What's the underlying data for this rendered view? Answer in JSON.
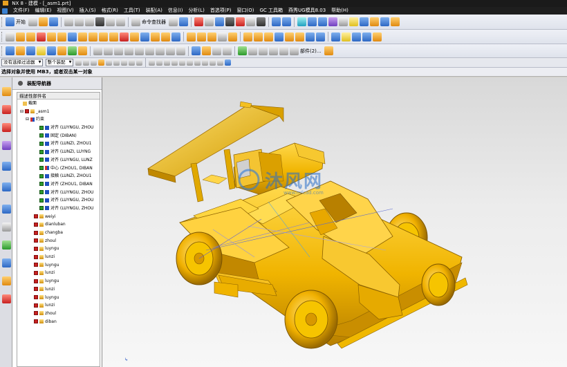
{
  "window": {
    "title": "NX 8 - 建模 - [_asm1.prt]"
  },
  "menubar": {
    "items": [
      "文件(F)",
      "编辑(E)",
      "视图(V)",
      "插入(S)",
      "格式(R)",
      "工具(T)",
      "装配(A)",
      "信息(I)",
      "分析(L)",
      "首选项(P)",
      "窗口(O)",
      "GC 工具箱",
      "燕秀UG模具8.03",
      "帮助(H)"
    ]
  },
  "toolbar": {
    "start_label": "开始",
    "command_finder_label": "命令查找器",
    "assembly_label": "部件(2)..."
  },
  "selection": {
    "filter_value": "没有选择过滤器",
    "scope_value": "整个装配"
  },
  "cue": {
    "text": "选择对象并使用 MB3，或者双击某一对象"
  },
  "navigator": {
    "title": "装配导航器",
    "column_header": "描述性部件名",
    "sections_label": "截面",
    "root_label": "_asm1",
    "constraints_label": "约束",
    "constraints": [
      "对齐 (LUYNGU, ZHOU",
      "固定 (DIBAN)",
      "对齐 (LUNZI, ZHOU1",
      "对齐 (LUNZI, LUYNG",
      "对齐 (LUYNGU, LUNZ",
      "中心 (ZHOU1, DIBAN",
      "接触 (LUNZI, ZHOU1",
      "对齐 (ZHOU1, DIBAN",
      "对齐 (LUYNGU, ZHOU",
      "对齐 (LUYNGU, ZHOU",
      "对齐 (LUYNGU, ZHOU"
    ],
    "components": [
      "weiyi",
      "dianluban",
      "changba",
      "zhoul",
      "luyngu",
      "lunzi",
      "luyngu",
      "lunzi",
      "luyngu",
      "lunzi",
      "luyngu",
      "lunzi",
      "zhoul",
      "diban"
    ]
  },
  "graphics": {
    "watermark_text": "沐风网",
    "watermark_url": "www.mfcad.com"
  },
  "colors": {
    "model": "#f0b800",
    "model_shadow": "#b88400",
    "model_light": "#ffd84a"
  }
}
